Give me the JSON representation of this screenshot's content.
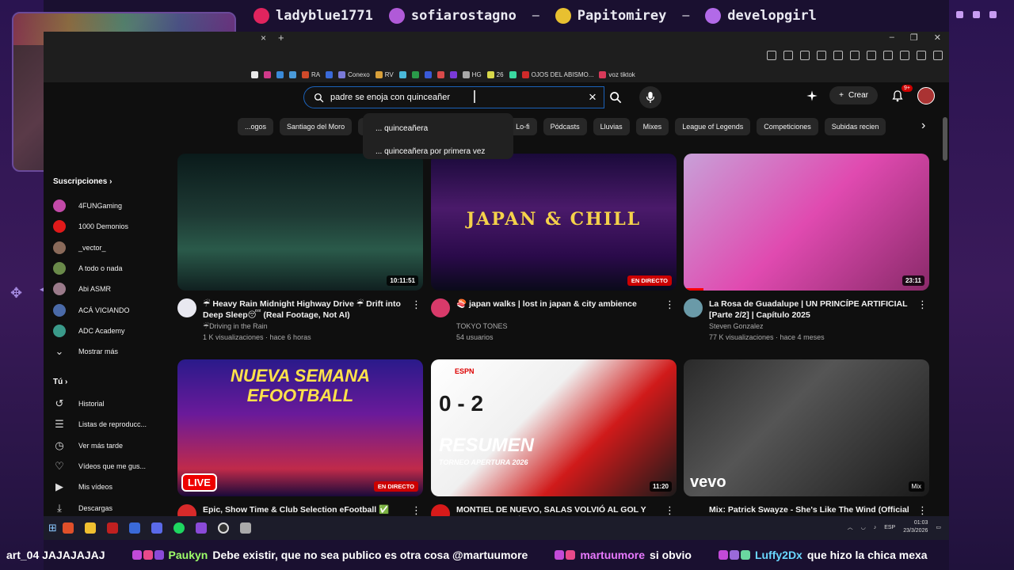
{
  "overlay": {
    "top_ticker": [
      {
        "icon": "heart-icon",
        "name": "ladyblue1771",
        "color": "#e0245e"
      },
      {
        "icon": "crown-icon",
        "name": "sofiarostagno",
        "color": "#b05ad8"
      },
      {
        "icon": "coin-icon",
        "name": "Papitomirey",
        "color": "#e8c030"
      },
      {
        "icon": "gem-icon",
        "name": "developgirl",
        "color": "#b26ae8"
      }
    ],
    "separator": "–",
    "chat": [
      {
        "user": "",
        "msg": "art_04 JAJAJAJAJ"
      },
      {
        "user": "Paukyn",
        "msg": "Debe existir, que no sea publico es otra cosa @martuumore"
      },
      {
        "user": "martuumore",
        "msg": "si obvio"
      },
      {
        "user": "Luffy2Dx",
        "msg": "que hizo la chica mexa"
      }
    ]
  },
  "browser": {
    "tab_close": "×",
    "tab_add": "+",
    "window_controls": [
      "–",
      "❐",
      "✕"
    ],
    "bookmarks": [
      {
        "label": "",
        "color": "#e8e8e8"
      },
      {
        "label": "",
        "color": "#d03a8a"
      },
      {
        "label": "",
        "color": "#3a8ad8"
      },
      {
        "label": "",
        "color": "#4a9ad8"
      },
      {
        "label": "RA",
        "color": "#d04a2a"
      },
      {
        "label": "",
        "color": "#3a6ad8"
      },
      {
        "label": "Conexo",
        "color": "#7a7ad8"
      },
      {
        "label": "RV",
        "color": "#d8a03a"
      },
      {
        "label": "",
        "color": "#4ab8d8"
      },
      {
        "label": "",
        "color": "#2a9a4a"
      },
      {
        "label": "",
        "color": "#3a5ad8"
      },
      {
        "label": "",
        "color": "#d84a4a"
      },
      {
        "label": "",
        "color": "#7a3ad8"
      },
      {
        "label": "HG",
        "color": "#a8a8a8"
      },
      {
        "label": "26",
        "color": "#d8d84a"
      },
      {
        "label": "",
        "color": "#3ad8a0"
      },
      {
        "label": "OJOS DEL ABISMO...",
        "color": "#d02a2a"
      },
      {
        "label": "voz tiktok",
        "color": "#d83a5a"
      }
    ]
  },
  "youtube": {
    "search_value": "padre se enoja con quinceañer",
    "clear_icon": "×",
    "suggestions": [
      "... quinceañera",
      "... quinceañera por primera vez"
    ],
    "create_label": "Crear",
    "notif_badge": "9+",
    "chips": [
      "...ogos",
      "Santiago del Moro",
      "E...",
      "",
      "",
      "Música",
      "Lo-fi",
      "Pódcasts",
      "Lluvias",
      "Mixes",
      "League of Legends",
      "Competiciones",
      "Subidas recien"
    ],
    "chip_next": "›"
  },
  "sidebar": {
    "subscriptions_title": "Suscripciones",
    "subscriptions": [
      {
        "label": "4FUNGaming",
        "color": "#c24aa8"
      },
      {
        "label": "1000 Demonios",
        "color": "#e01a1a"
      },
      {
        "label": "_vector_",
        "color": "#8a6a5a"
      },
      {
        "label": "A todo o nada",
        "color": "#6a8a4a"
      },
      {
        "label": "Abi ASMR",
        "color": "#9a7a8a"
      },
      {
        "label": "ACÁ VICIANDO",
        "color": "#4a6aa8"
      },
      {
        "label": "ADC Academy",
        "color": "#3a9a8a"
      }
    ],
    "show_more": "Mostrar más",
    "you_title": "Tú",
    "you_items": [
      {
        "icon": "history-icon",
        "glyph": "↺",
        "label": "Historial"
      },
      {
        "icon": "playlists-icon",
        "glyph": "☰",
        "label": "Listas de reproducc..."
      },
      {
        "icon": "watch-later-icon",
        "glyph": "◷",
        "label": "Ver más tarde"
      },
      {
        "icon": "liked-icon",
        "glyph": "♡",
        "label": "Vídeos que me gus..."
      },
      {
        "icon": "your-videos-icon",
        "glyph": "▶",
        "label": "Mis vídeos"
      },
      {
        "icon": "downloads-icon",
        "glyph": "⤓",
        "label": "Descargas"
      }
    ]
  },
  "videos": [
    {
      "title": "☔ Heavy Rain Midnight Highway Drive ☔ Drift into Deep Sleep😴 (Real Footage, Not AI)",
      "channel": "☔Driving in the Rain",
      "stats": "1 K visualizaciones · hace 6 horas",
      "duration": "10:11:51",
      "avatar": "#e8e8f0"
    },
    {
      "title": "🍣 japan walks | lost in japan & city ambience",
      "channel": "TOKYO TONES",
      "stats": "54 usuarios",
      "duration": "EN DIRECTO",
      "avatar": "#d83a6a",
      "thumb_text": "JAPAN & CHILL"
    },
    {
      "title": "La Rosa de Guadalupe | UN PRINCÍPE ARTIFICIAL [Parte 2/2] | Capítulo 2025",
      "channel": "Steven Gonzalez",
      "stats": "77 K visualizaciones · hace 4 meses",
      "duration": "23:11",
      "avatar": "#6a9aa8"
    },
    {
      "title": "Epic, Show Time & Club Selection eFootball ✅ Tevez & Dybala & Cáliz & Vidal & ... LIVE eFootball",
      "channel": "",
      "stats": "",
      "duration": "EN DIRECTO",
      "avatar": "#d82a2a",
      "thumb_text": "NUEVA SEMANA EFOOTBALL",
      "live_text": "LIVE"
    },
    {
      "title": "MONTIEL DE NUEVO, SALAS VOLVIÓ AL GOL Y RIVER FESTEJÓ | Estudiantes RC 0-2 River | RESUMEN",
      "channel": "",
      "stats": "",
      "duration": "11:20",
      "avatar": "#d81a1a",
      "score": "0 - 2",
      "resumen": "RESUMEN",
      "torneo": "TORNEO APERTURA 2026",
      "espn": "ESPN"
    },
    {
      "title": "Mix: Patrick Swayze - She's Like The Wind (Official HD Video) ft. Wendy Fraser",
      "channel": "",
      "stats": "",
      "duration": "Mix",
      "avatar": "",
      "vevo": "vevo"
    }
  ],
  "taskbar": {
    "lang": "ESP",
    "time": "01:03",
    "date": "23/3/2026"
  }
}
